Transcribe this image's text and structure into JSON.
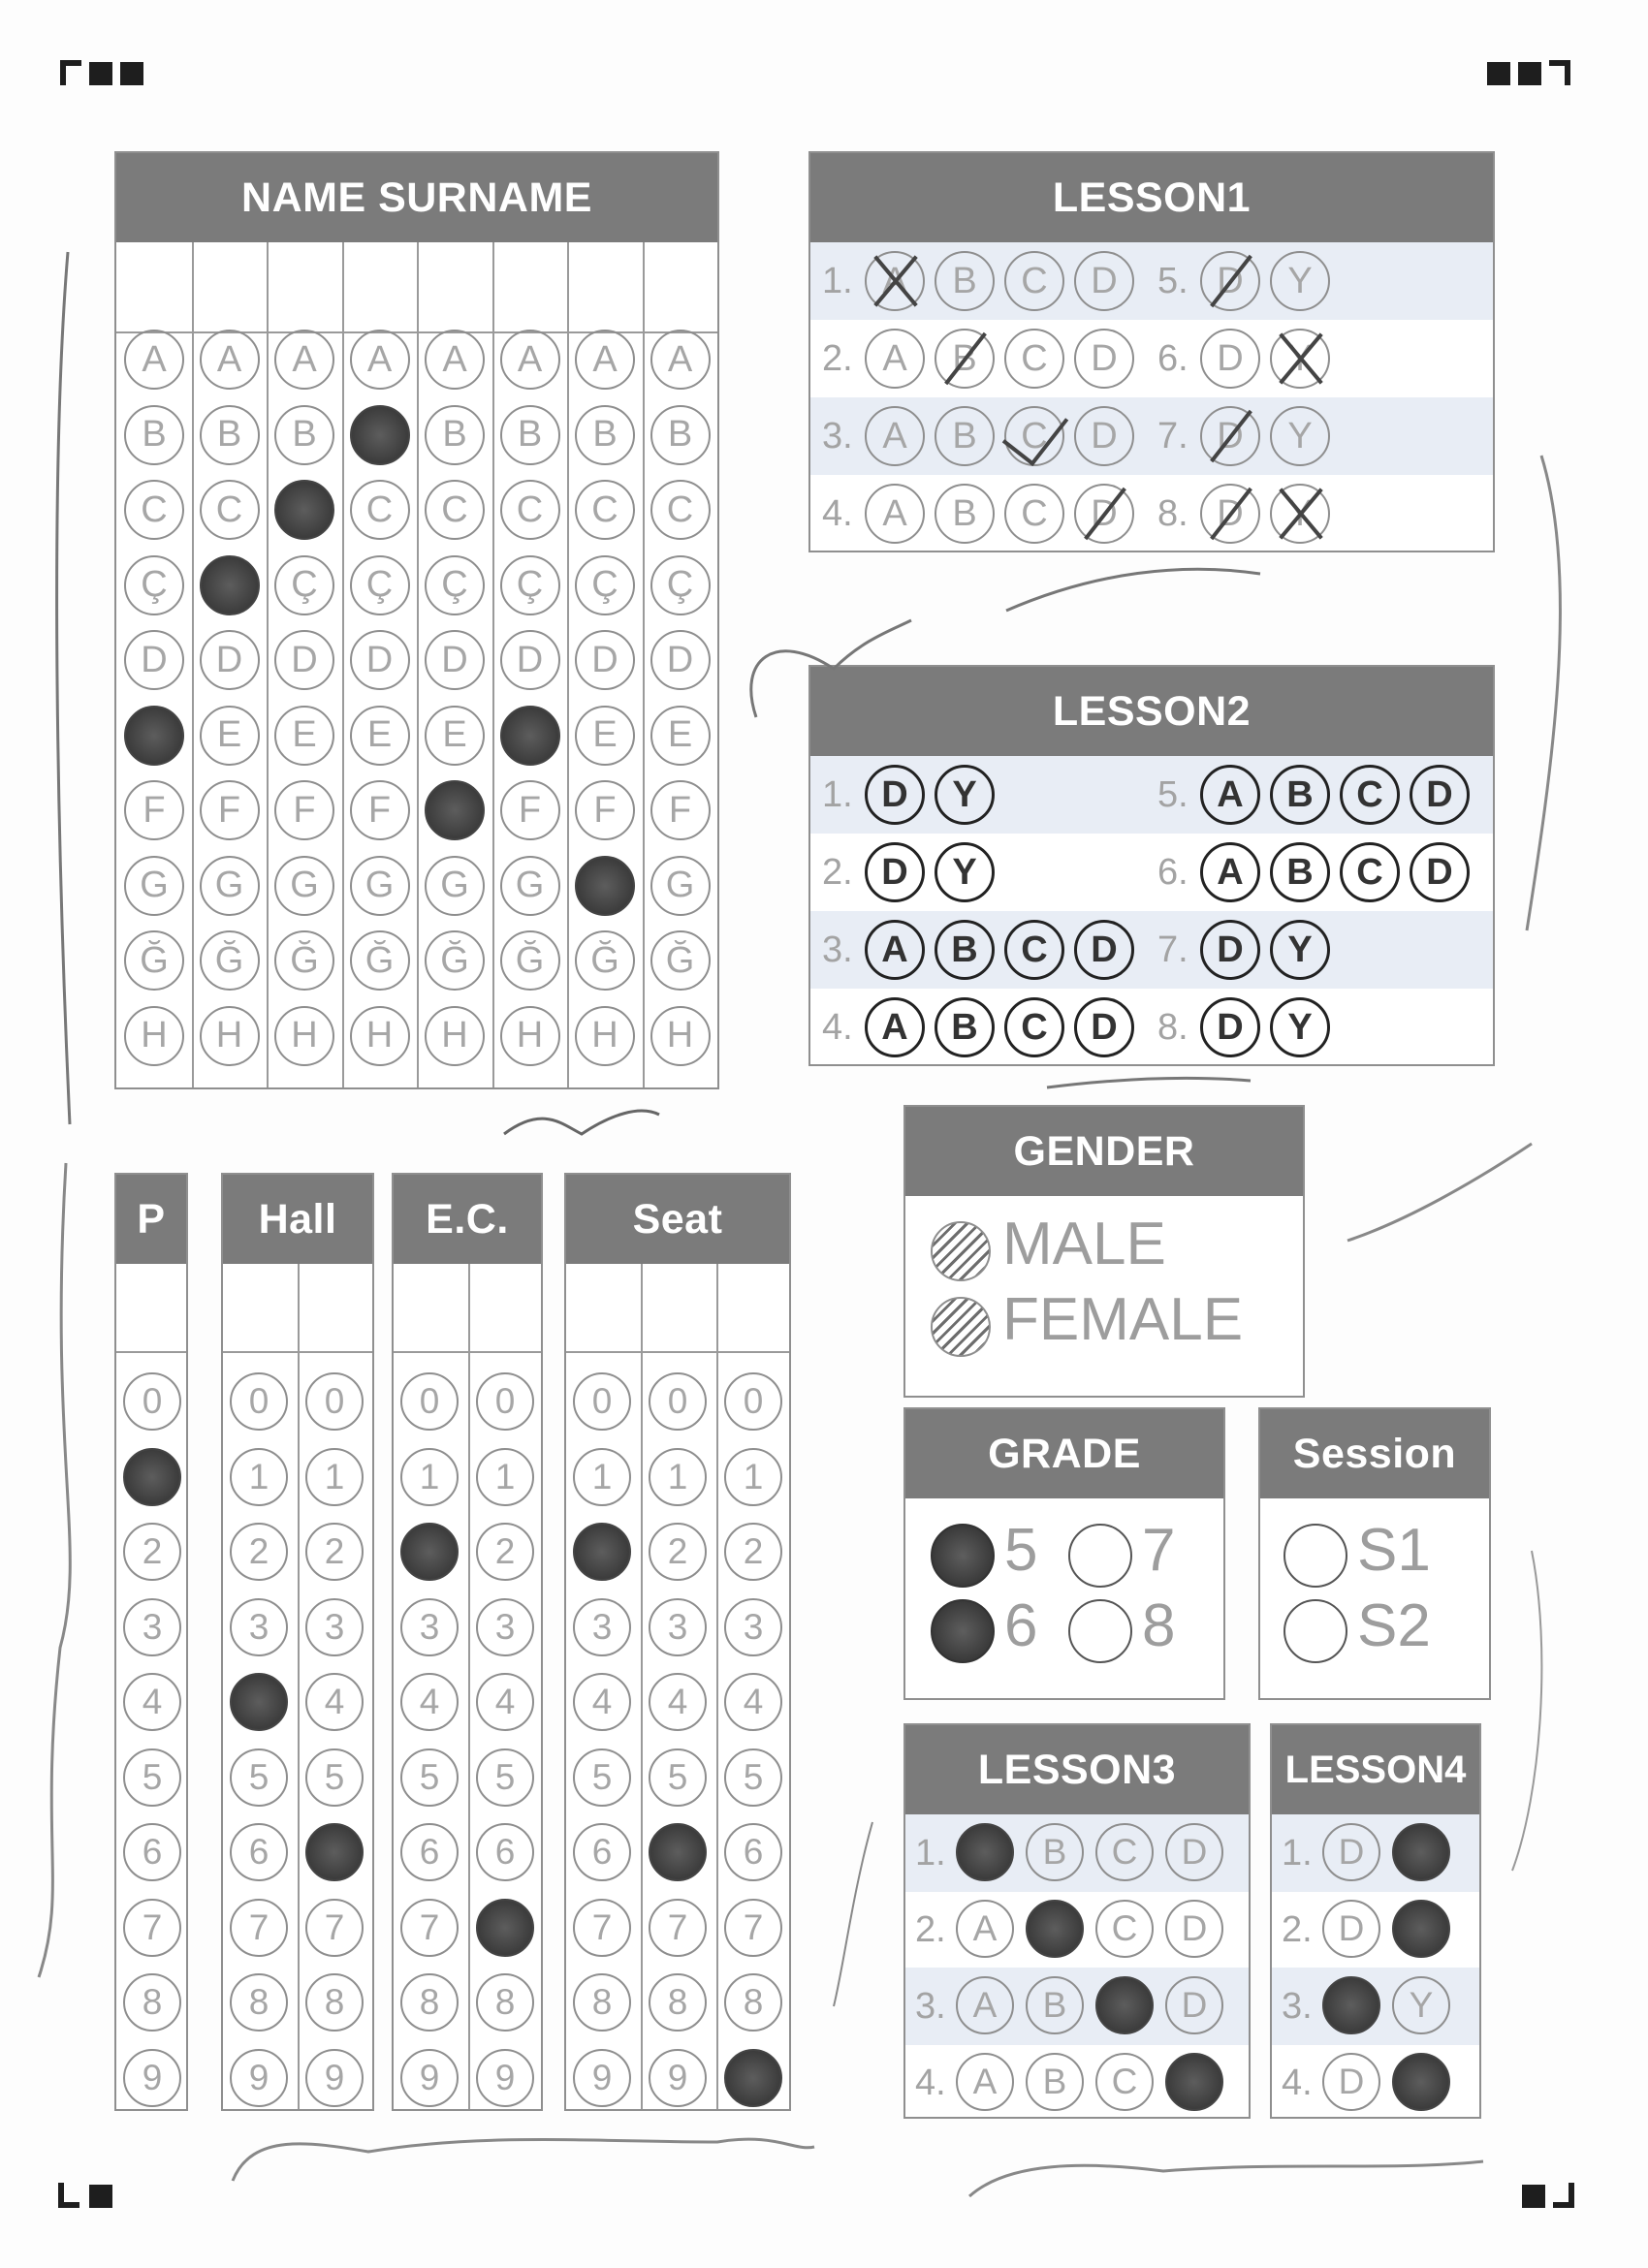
{
  "name_surname": {
    "title": "NAME SURNAME",
    "letters": [
      "A",
      "B",
      "C",
      "Ç",
      "D",
      "E",
      "F",
      "G",
      "Ğ",
      "H"
    ]
  },
  "lesson1": {
    "title": "LESSON1",
    "questions": [
      {
        "num": "1.",
        "options": [
          "A",
          "B",
          "C",
          "D"
        ]
      },
      {
        "num": "2.",
        "options": [
          "A",
          "B",
          "C",
          "D"
        ]
      },
      {
        "num": "3.",
        "options": [
          "A",
          "B",
          "C",
          "D"
        ]
      },
      {
        "num": "4.",
        "options": [
          "A",
          "B",
          "C",
          "D"
        ]
      },
      {
        "num": "5.",
        "options": [
          "D",
          "Y"
        ]
      },
      {
        "num": "6.",
        "options": [
          "D",
          "Y"
        ]
      },
      {
        "num": "7.",
        "options": [
          "D",
          "Y"
        ]
      },
      {
        "num": "8.",
        "options": [
          "D",
          "Y"
        ]
      }
    ]
  },
  "lesson2": {
    "title": "LESSON2",
    "questions": [
      {
        "num": "1.",
        "options": [
          "D",
          "Y"
        ]
      },
      {
        "num": "2.",
        "options": [
          "D",
          "Y"
        ]
      },
      {
        "num": "3.",
        "options": [
          "A",
          "B",
          "C",
          "D"
        ]
      },
      {
        "num": "4.",
        "options": [
          "A",
          "B",
          "C",
          "D"
        ]
      },
      {
        "num": "5.",
        "options": [
          "A",
          "B",
          "C",
          "D"
        ]
      },
      {
        "num": "6.",
        "options": [
          "A",
          "B",
          "C",
          "D"
        ]
      },
      {
        "num": "7.",
        "options": [
          "D",
          "Y"
        ]
      },
      {
        "num": "8.",
        "options": [
          "D",
          "Y"
        ]
      }
    ]
  },
  "p": {
    "title": "P"
  },
  "hall": {
    "title": "Hall"
  },
  "ec": {
    "title": "E.C."
  },
  "seat": {
    "title": "Seat"
  },
  "digits": [
    "0",
    "1",
    "2",
    "3",
    "4",
    "5",
    "6",
    "7",
    "8",
    "9"
  ],
  "gender": {
    "title": "GENDER",
    "male": "MALE",
    "female": "FEMALE"
  },
  "grade": {
    "title": "GRADE",
    "values": [
      "5",
      "7",
      "6",
      "8"
    ]
  },
  "session": {
    "title": "Session",
    "values": [
      "S1",
      "S2"
    ]
  },
  "lesson3": {
    "title": "LESSON3",
    "questions": [
      {
        "num": "1.",
        "options": [
          "A",
          "B",
          "C",
          "D"
        ]
      },
      {
        "num": "2.",
        "options": [
          "A",
          "B",
          "C",
          "D"
        ]
      },
      {
        "num": "3.",
        "options": [
          "A",
          "B",
          "C",
          "D"
        ]
      },
      {
        "num": "4.",
        "options": [
          "A",
          "B",
          "C",
          "D"
        ]
      }
    ]
  },
  "lesson4": {
    "title": "LESSON4",
    "questions": [
      {
        "num": "1.",
        "options": [
          "D",
          "Y"
        ]
      },
      {
        "num": "2.",
        "options": [
          "D",
          "Y"
        ]
      },
      {
        "num": "3.",
        "options": [
          "D",
          "Y"
        ]
      },
      {
        "num": "4.",
        "options": [
          "D",
          "Y"
        ]
      }
    ]
  },
  "marks": {
    "name_surname": [
      5,
      3,
      2,
      1,
      6,
      5,
      7,
      null
    ],
    "lesson1": [
      "A-cross",
      "B-slash",
      "C-check",
      "D-slash",
      "D-slash",
      "Y-cross",
      "D-slash",
      "D-slash Y-cross"
    ],
    "p": 1,
    "hall": [
      4,
      6
    ],
    "ec": [
      2,
      7
    ],
    "seat": [
      2,
      6,
      9
    ],
    "grade": [
      "5",
      "6"
    ],
    "lesson3": [
      "A",
      "B",
      "C",
      "D"
    ],
    "lesson4": [
      "Y",
      "Y",
      "D",
      "Y"
    ]
  }
}
